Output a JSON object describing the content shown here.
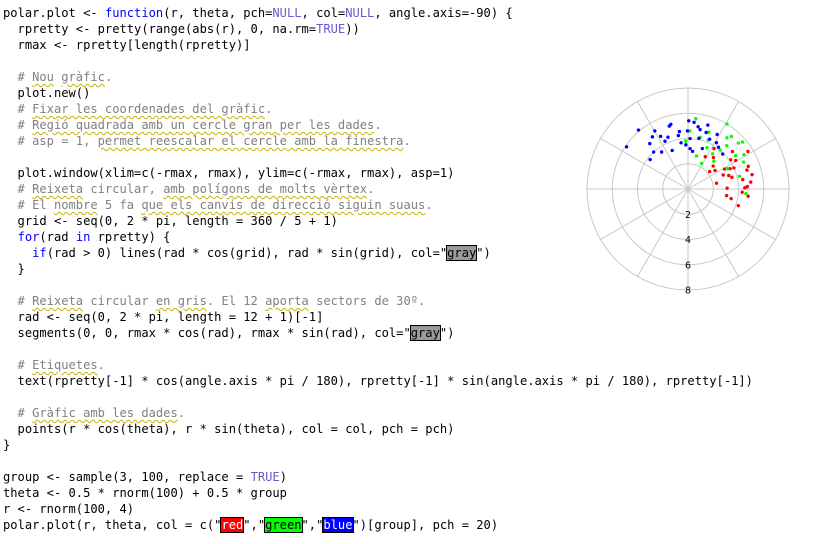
{
  "code_lines": [
    [
      {
        "t": "polar.plot <- "
      },
      {
        "t": "function",
        "c": "t-kw"
      },
      {
        "t": "(r, theta, pch="
      },
      {
        "t": "NULL",
        "c": "t-const"
      },
      {
        "t": ", col="
      },
      {
        "t": "NULL",
        "c": "t-const"
      },
      {
        "t": ", angle.axis=-90) {"
      }
    ],
    [
      {
        "t": "  rpretty <- pretty(range(abs(r), 0, na.rm="
      },
      {
        "t": "TRUE",
        "c": "t-const"
      },
      {
        "t": "))"
      }
    ],
    [
      {
        "t": "  rmax <- rpretty[length(rpretty)]"
      }
    ],
    [
      {
        "t": ""
      }
    ],
    [
      {
        "t": "  # ",
        "c": "t-cmt"
      },
      {
        "t": "Nou",
        "c": "t-cmt sq"
      },
      {
        "t": " ",
        "c": "t-cmt"
      },
      {
        "t": "gràfic",
        "c": "t-cmt sq"
      },
      {
        "t": ".",
        "c": "t-cmt"
      }
    ],
    [
      {
        "t": "  plot.new()"
      }
    ],
    [
      {
        "t": "  # ",
        "c": "t-cmt"
      },
      {
        "t": "Fixar les coordenades del gràfic",
        "c": "t-cmt sq"
      },
      {
        "t": ".",
        "c": "t-cmt"
      }
    ],
    [
      {
        "t": "  # ",
        "c": "t-cmt"
      },
      {
        "t": "Regió quadrada amb un cercle gran per les dades",
        "c": "t-cmt sq"
      },
      {
        "t": ".",
        "c": "t-cmt"
      }
    ],
    [
      {
        "t": "  # asp = 1, ",
        "c": "t-cmt"
      },
      {
        "t": "permet reescalar el cercle amb la finestra",
        "c": "t-cmt sq"
      },
      {
        "t": ".",
        "c": "t-cmt"
      }
    ],
    [
      {
        "t": ""
      }
    ],
    [
      {
        "t": "  plot.window(xlim=c(-rmax, rmax), ylim=c(-rmax, rmax), asp=1)"
      }
    ],
    [
      {
        "t": "  # ",
        "c": "t-cmt"
      },
      {
        "t": "Reixeta",
        "c": "t-cmt sq"
      },
      {
        "t": " circular, ",
        "c": "t-cmt"
      },
      {
        "t": "amb polígons de molts vèrtex",
        "c": "t-cmt sq"
      },
      {
        "t": ".",
        "c": "t-cmt"
      }
    ],
    [
      {
        "t": "  # El ",
        "c": "t-cmt"
      },
      {
        "t": "nombre",
        "c": "t-cmt sq"
      },
      {
        "t": " 5 fa ",
        "c": "t-cmt"
      },
      {
        "t": "que els canvis de direcció siguin suaus",
        "c": "t-cmt sq"
      },
      {
        "t": ".",
        "c": "t-cmt"
      }
    ],
    [
      {
        "t": "  grid <- seq(0, 2 * pi, length = 360 / 5 + 1)"
      }
    ],
    [
      {
        "t": "  "
      },
      {
        "t": "for",
        "c": "t-kw"
      },
      {
        "t": "(rad "
      },
      {
        "t": "in",
        "c": "t-kw"
      },
      {
        "t": " rpretty) {"
      }
    ],
    [
      {
        "t": "    "
      },
      {
        "t": "if",
        "c": "t-kw"
      },
      {
        "t": "(rad > 0) lines(rad * cos(grid), rad * sin(grid), col=\""
      },
      {
        "t": "gray",
        "c": "hl-gray"
      },
      {
        "t": "\")"
      }
    ],
    [
      {
        "t": "  }"
      }
    ],
    [
      {
        "t": ""
      }
    ],
    [
      {
        "t": "  # ",
        "c": "t-cmt"
      },
      {
        "t": "Reixeta",
        "c": "t-cmt sq"
      },
      {
        "t": " circular ",
        "c": "t-cmt"
      },
      {
        "t": "en gris",
        "c": "t-cmt sq"
      },
      {
        "t": ". El 12 ",
        "c": "t-cmt"
      },
      {
        "t": "aporta",
        "c": "t-cmt sq"
      },
      {
        "t": " sectors de 30º.",
        "c": "t-cmt"
      }
    ],
    [
      {
        "t": "  rad <- seq(0, 2 * pi, length = 12 + 1)[-1]"
      }
    ],
    [
      {
        "t": "  segments(0, 0, rmax * cos(rad), rmax * sin(rad), col=\""
      },
      {
        "t": "gray",
        "c": "hl-gray"
      },
      {
        "t": "\")"
      }
    ],
    [
      {
        "t": ""
      }
    ],
    [
      {
        "t": "  # ",
        "c": "t-cmt"
      },
      {
        "t": "Etiquetes",
        "c": "t-cmt sq"
      },
      {
        "t": ".",
        "c": "t-cmt"
      }
    ],
    [
      {
        "t": "  text(rpretty[-1] * cos(angle.axis * pi / 180), rpretty[-1] * sin(angle.axis * pi / 180), rpretty[-1])"
      }
    ],
    [
      {
        "t": ""
      }
    ],
    [
      {
        "t": "  # ",
        "c": "t-cmt"
      },
      {
        "t": "Gràfic amb les dades",
        "c": "t-cmt sq"
      },
      {
        "t": ".",
        "c": "t-cmt"
      }
    ],
    [
      {
        "t": "  points(r * cos(theta), r * sin(theta), col = col, pch = pch)"
      }
    ],
    [
      {
        "t": "}"
      }
    ],
    [
      {
        "t": ""
      }
    ],
    [
      {
        "t": "group <- sample(3, 100, replace = "
      },
      {
        "t": "TRUE",
        "c": "t-const"
      },
      {
        "t": ")"
      }
    ],
    [
      {
        "t": "theta <- 0.5 * rnorm(100) + 0.5 * group"
      }
    ],
    [
      {
        "t": "r <- rnorm(100, 4)"
      }
    ],
    [
      {
        "t": "polar.plot(r, theta, col = c(\""
      },
      {
        "t": "red",
        "c": "hl-red"
      },
      {
        "t": "\",\""
      },
      {
        "t": "green",
        "c": "hl-green"
      },
      {
        "t": "\",\""
      },
      {
        "t": "blue",
        "c": "hl-blue"
      },
      {
        "t": "\")[group], pch = 20)"
      }
    ]
  ],
  "plot": {
    "ring_labels": [
      "2",
      "4",
      "6",
      "8"
    ],
    "ring_values": [
      2,
      4,
      6,
      8
    ],
    "rmax": 8,
    "spokes": 12,
    "grid_color": "#c8c8c8",
    "series": [
      {
        "color": "#ff0000",
        "points": [
          [
            4.0,
            0.43
          ],
          [
            4.9,
            0.31
          ],
          [
            3.6,
            0.26
          ],
          [
            3.3,
            0.5
          ],
          [
            5.0,
            0.11
          ],
          [
            4.4,
            0.54
          ],
          [
            2.3,
            0.2
          ],
          [
            3.1,
            0.02
          ],
          [
            4.7,
            0.04
          ],
          [
            2.6,
            0.6
          ],
          [
            3.9,
            0.79
          ],
          [
            5.1,
            0.36
          ],
          [
            3.1,
            -0.17
          ],
          [
            2.7,
            0.74
          ],
          [
            4.4,
            0.17
          ],
          [
            5.6,
            0.56
          ],
          [
            4.3,
            -0.06
          ],
          [
            3.8,
            1.0
          ],
          [
            4.2,
            -0.32
          ],
          [
            3.7,
            0.45
          ],
          [
            3.2,
            0.89
          ],
          [
            4.8,
            -0.12
          ],
          [
            2.2,
            0.68
          ],
          [
            4.1,
            0.6
          ],
          [
            3.4,
            0.32
          ],
          [
            5.2,
            0.22
          ],
          [
            3.0,
            0.38
          ],
          [
            4.6,
            0.7
          ],
          [
            3.5,
            -0.22
          ],
          [
            2.9,
            1.08
          ],
          [
            4.5,
            0.02
          ]
        ]
      },
      {
        "color": "#00ff00",
        "points": [
          [
            5.6,
            1.46
          ],
          [
            4.6,
            0.61
          ],
          [
            5.4,
            0.88
          ],
          [
            6.0,
            1.03
          ],
          [
            3.6,
            1.14
          ],
          [
            4.2,
            1.34
          ],
          [
            2.3,
            1.08
          ],
          [
            4.6,
            0.84
          ],
          [
            5.2,
            0.55
          ],
          [
            4.2,
            0.24
          ],
          [
            4.9,
            0.45
          ],
          [
            3.8,
            1.62
          ],
          [
            4.6,
            1.54
          ],
          [
            5.1,
            0.92
          ],
          [
            3.4,
            0.96
          ],
          [
            2.7,
            1.32
          ],
          [
            4.2,
            1.18
          ],
          [
            5.4,
            0.74
          ],
          [
            3.0,
            0.82
          ],
          [
            4.8,
            1.22
          ],
          [
            5.7,
            0.71
          ],
          [
            3.5,
            0.48
          ],
          [
            4.0,
            0.88
          ],
          [
            4.6,
            -0.08
          ]
        ]
      },
      {
        "color": "#0000ff",
        "points": [
          [
            5.3,
            1.83
          ],
          [
            6.1,
            2.27
          ],
          [
            5.9,
            2.54
          ],
          [
            4.4,
            1.94
          ],
          [
            4.6,
            1.58
          ],
          [
            5.0,
            1.41
          ],
          [
            4.7,
            2.05
          ],
          [
            3.6,
            2.19
          ],
          [
            4.3,
            1.16
          ],
          [
            4.1,
            1.36
          ],
          [
            3.7,
            1.72
          ],
          [
            3.2,
            1.52
          ],
          [
            4.3,
            1.75
          ],
          [
            5.3,
            1.27
          ],
          [
            4.0,
            1.53
          ],
          [
            5.3,
            2.09
          ],
          [
            3.8,
            2.48
          ],
          [
            4.1,
            0.94
          ],
          [
            5.4,
            1.56
          ],
          [
            3.3,
            1.96
          ],
          [
            4.8,
            1.37
          ],
          [
            3.4,
            1.23
          ],
          [
            4.9,
            1.08
          ],
          [
            5.2,
            1.86
          ],
          [
            4.0,
            2.32
          ],
          [
            3.9,
            0.79
          ],
          [
            4.6,
            1.72
          ],
          [
            4.7,
            2.27
          ],
          [
            3.5,
            1.62
          ],
          [
            4.3,
            1.02
          ],
          [
            4.7,
            1.26
          ],
          [
            5.0,
            2.17
          ],
          [
            3.0,
            1.45
          ],
          [
            4.2,
            2.02
          ],
          [
            5.3,
            1.48
          ]
        ]
      }
    ]
  }
}
